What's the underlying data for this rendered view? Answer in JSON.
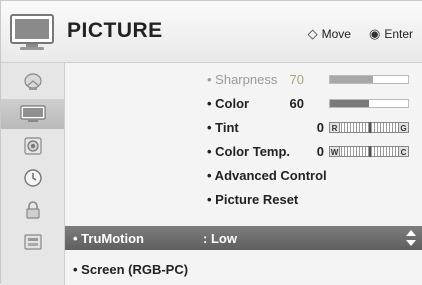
{
  "header": {
    "title": "PICTURE",
    "move_glyph": "◇",
    "move_label": "Move",
    "enter_glyph": "◉",
    "enter_label": "Enter",
    "icon": "tv-screen-icon"
  },
  "sidebar": {
    "items": [
      {
        "name": "satellite-dish-icon",
        "active": false
      },
      {
        "name": "picture-icon",
        "active": true
      },
      {
        "name": "speaker-icon",
        "active": false
      },
      {
        "name": "clock-icon",
        "active": false
      },
      {
        "name": "lock-icon",
        "active": false
      },
      {
        "name": "input-icon",
        "active": false
      }
    ]
  },
  "menu": {
    "sharpness": {
      "label": "• Sharpness",
      "value": "70",
      "level": 0.55
    },
    "color": {
      "label": "• Color",
      "value": "60",
      "level": 0.5
    },
    "tint": {
      "label": "• Tint",
      "value": "0",
      "left": "R",
      "right": "G"
    },
    "color_temp": {
      "label": "• Color Temp.",
      "value": "0",
      "left": "W",
      "right": "C"
    },
    "advanced": {
      "label": "• Advanced Control"
    },
    "reset": {
      "label": "• Picture Reset"
    },
    "trumotion": {
      "label": "• TruMotion",
      "value": ": Low"
    },
    "screen": {
      "label": "• Screen (RGB-PC)"
    }
  },
  "colors": {
    "selected_bg": "#6e6e6e",
    "bar_fill": "#7a7a7a",
    "dim_text": "#9a9a9a"
  }
}
